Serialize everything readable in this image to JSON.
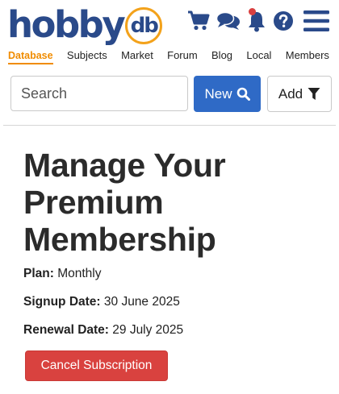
{
  "brand": {
    "word": "hobby",
    "mark": "db",
    "primary_color": "#2a4a8a",
    "accent_color": "#f3a21b"
  },
  "header_icons": [
    {
      "name": "cart-icon"
    },
    {
      "name": "chat-icon"
    },
    {
      "name": "bell-icon",
      "has_badge": true,
      "badge_color": "#d94040"
    },
    {
      "name": "help-icon"
    },
    {
      "name": "menu-icon"
    }
  ],
  "nav": {
    "active_color": "#f08c00",
    "items": [
      {
        "label": "Database",
        "active": true
      },
      {
        "label": "Subjects"
      },
      {
        "label": "Market"
      },
      {
        "label": "Forum"
      },
      {
        "label": "Blog"
      },
      {
        "label": "Local"
      },
      {
        "label": "Members"
      }
    ]
  },
  "search": {
    "placeholder": "Search",
    "value": "",
    "new_label": "New",
    "new_icon": "search-icon",
    "new_color": "#2f6ac6",
    "add_label": "Add",
    "add_icon": "filter-icon"
  },
  "main": {
    "title": "Manage Your Premium Membership",
    "plan": {
      "label": "Plan:",
      "value": "Monthly"
    },
    "signup": {
      "label": "Signup Date:",
      "value": "30 June 2025"
    },
    "renewal": {
      "label": "Renewal Date:",
      "value": "29 July 2025"
    },
    "cancel_label": "Cancel Subscription",
    "cancel_color": "#d9423f"
  }
}
